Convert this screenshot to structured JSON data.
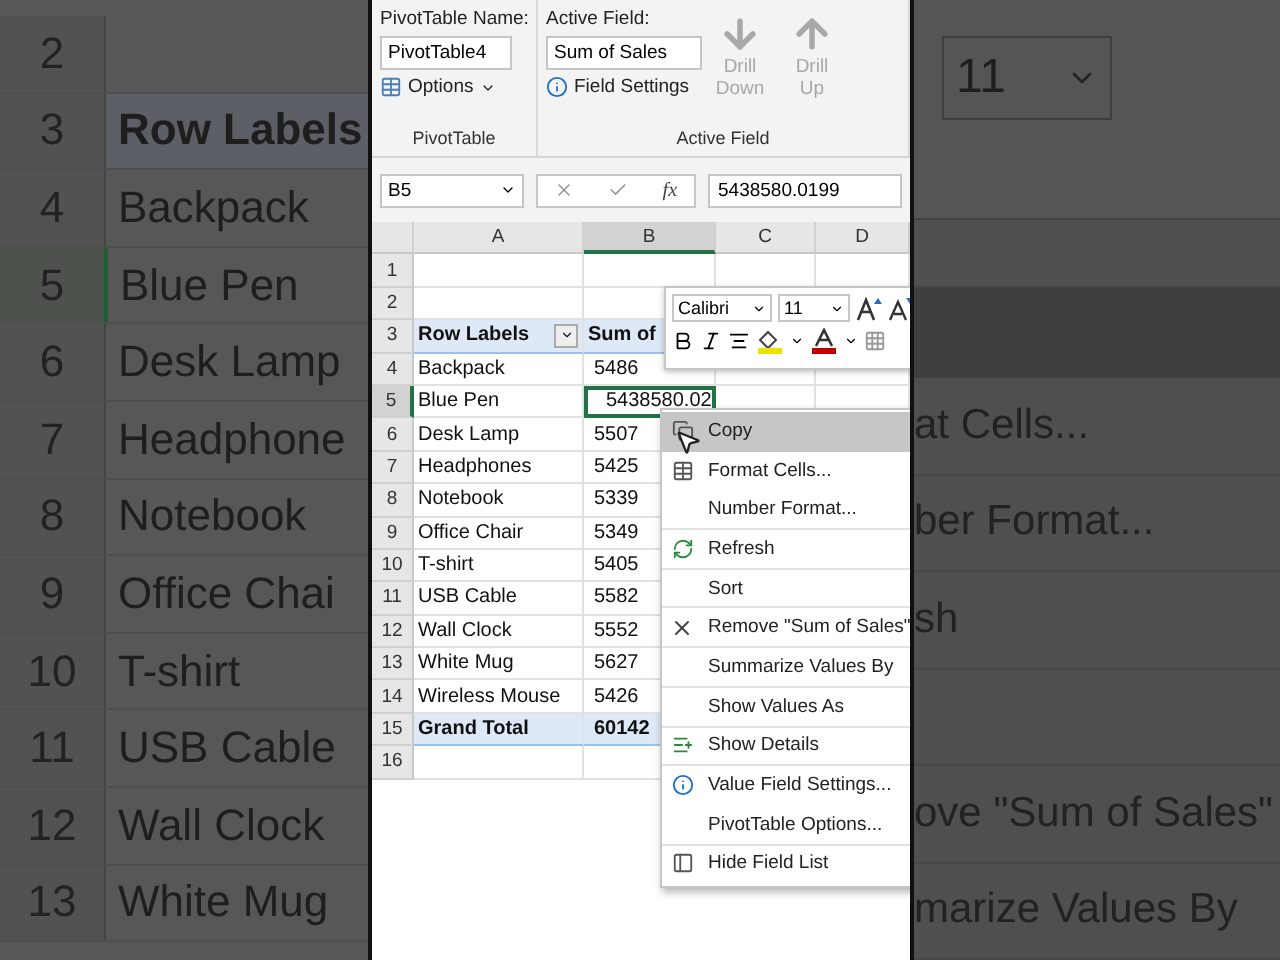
{
  "backdrop_left": {
    "rows": [
      {
        "number": "2",
        "kind": "blank"
      },
      {
        "number": "3",
        "label": "Row Labels",
        "kind": "header"
      },
      {
        "number": "4",
        "label": "Backpack",
        "kind": "item"
      },
      {
        "number": "5",
        "label": "Blue Pen",
        "kind": "item",
        "selected": true
      },
      {
        "number": "6",
        "label": "Desk Lamp",
        "kind": "item"
      },
      {
        "number": "7",
        "label": "Headphone",
        "kind": "item"
      },
      {
        "number": "8",
        "label": "Notebook",
        "kind": "item"
      },
      {
        "number": "9",
        "label": "Office Chai",
        "kind": "item"
      },
      {
        "number": "10",
        "label": "T-shirt",
        "kind": "item"
      },
      {
        "number": "11",
        "label": "USB Cable",
        "kind": "item"
      },
      {
        "number": "12",
        "label": "Wall Clock",
        "kind": "item"
      },
      {
        "number": "13",
        "label": "White Mug",
        "kind": "item"
      }
    ]
  },
  "ribbon": {
    "pivottable_group": {
      "name_label": "PivotTable Name:",
      "name_value": "PivotTable4",
      "options_button": "Options",
      "group_label": "PivotTable"
    },
    "active_field_group": {
      "field_label": "Active Field:",
      "field_value": "Sum of Sales",
      "settings_button": "Field Settings",
      "drill_down": {
        "label": "Drill Down",
        "disabled": true
      },
      "drill_up": {
        "label": "Drill Up",
        "disabled": true
      },
      "group_label": "Active Field"
    }
  },
  "formula_bar": {
    "name_box": "B5",
    "function_label": "fx",
    "formula": "5438580.0199"
  },
  "sheet": {
    "columns": [
      "A",
      "B",
      "C",
      "D"
    ],
    "rows": [
      {
        "number": "1",
        "kind": "blank",
        "selected": false
      },
      {
        "number": "2",
        "kind": "blank",
        "selected": false
      },
      {
        "number": "3",
        "kind": "header",
        "label": "Row Labels",
        "value": "Sum of",
        "selected": false
      },
      {
        "number": "4",
        "kind": "item",
        "label": "Backpack",
        "value": "5486",
        "selected": false
      },
      {
        "number": "5",
        "kind": "item",
        "label": "Blue Pen",
        "value": "5438580.02",
        "selected": true
      },
      {
        "number": "6",
        "kind": "item",
        "label": "Desk Lamp",
        "value": "5507",
        "selected": false
      },
      {
        "number": "7",
        "kind": "item",
        "label": "Headphones",
        "value": "5425",
        "selected": false
      },
      {
        "number": "8",
        "kind": "item",
        "label": "Notebook",
        "value": "5339",
        "selected": false
      },
      {
        "number": "9",
        "kind": "item",
        "label": "Office Chair",
        "value": "5349",
        "selected": false
      },
      {
        "number": "10",
        "kind": "item",
        "label": "T-shirt",
        "value": "5405",
        "selected": false
      },
      {
        "number": "11",
        "kind": "item",
        "label": "USB Cable",
        "value": "5582",
        "selected": false
      },
      {
        "number": "12",
        "kind": "item",
        "label": "Wall Clock",
        "value": "5552",
        "selected": false
      },
      {
        "number": "13",
        "kind": "item",
        "label": "White Mug",
        "value": "5627",
        "selected": false
      },
      {
        "number": "14",
        "kind": "item",
        "label": "Wireless Mouse",
        "value": "5426",
        "selected": false
      },
      {
        "number": "15",
        "kind": "total",
        "label": "Grand Total",
        "value": "60142",
        "selected": false
      },
      {
        "number": "16",
        "kind": "blank",
        "selected": false
      }
    ]
  },
  "mini_toolbar": {
    "font": "Calibri",
    "size": "11"
  },
  "context_menu": {
    "items": [
      {
        "label": "Copy",
        "selected": true,
        "separator_after": false
      },
      {
        "label": "Format Cells...",
        "selected": false,
        "separator_after": false
      },
      {
        "label": "Number Format...",
        "selected": false,
        "separator_after": true
      },
      {
        "label": "Refresh",
        "selected": false,
        "separator_after": true
      },
      {
        "label": "Sort",
        "selected": false,
        "separator_after": true
      },
      {
        "label": "Remove \"Sum of Sales\"",
        "selected": false,
        "separator_after": true
      },
      {
        "label": "Summarize Values By",
        "selected": false,
        "separator_after": true
      },
      {
        "label": "Show Values As",
        "selected": false,
        "separator_after": true
      },
      {
        "label": "Show Details",
        "selected": false,
        "separator_after": true
      },
      {
        "label": "Value Field Settings...",
        "selected": false,
        "separator_after": false
      },
      {
        "label": "PivotTable Options...",
        "selected": false,
        "separator_after": true
      },
      {
        "label": "Hide Field List",
        "selected": false,
        "separator_after": false
      }
    ]
  },
  "backdrop_right": {
    "size": "11",
    "items": [
      {
        "label": "at Cells..."
      },
      {
        "label": "ber Format..."
      },
      {
        "label": "sh"
      },
      {
        "label": "ove \"Sum of Sales\"",
        "gap_before": true
      },
      {
        "label": "marize Values By"
      }
    ]
  }
}
